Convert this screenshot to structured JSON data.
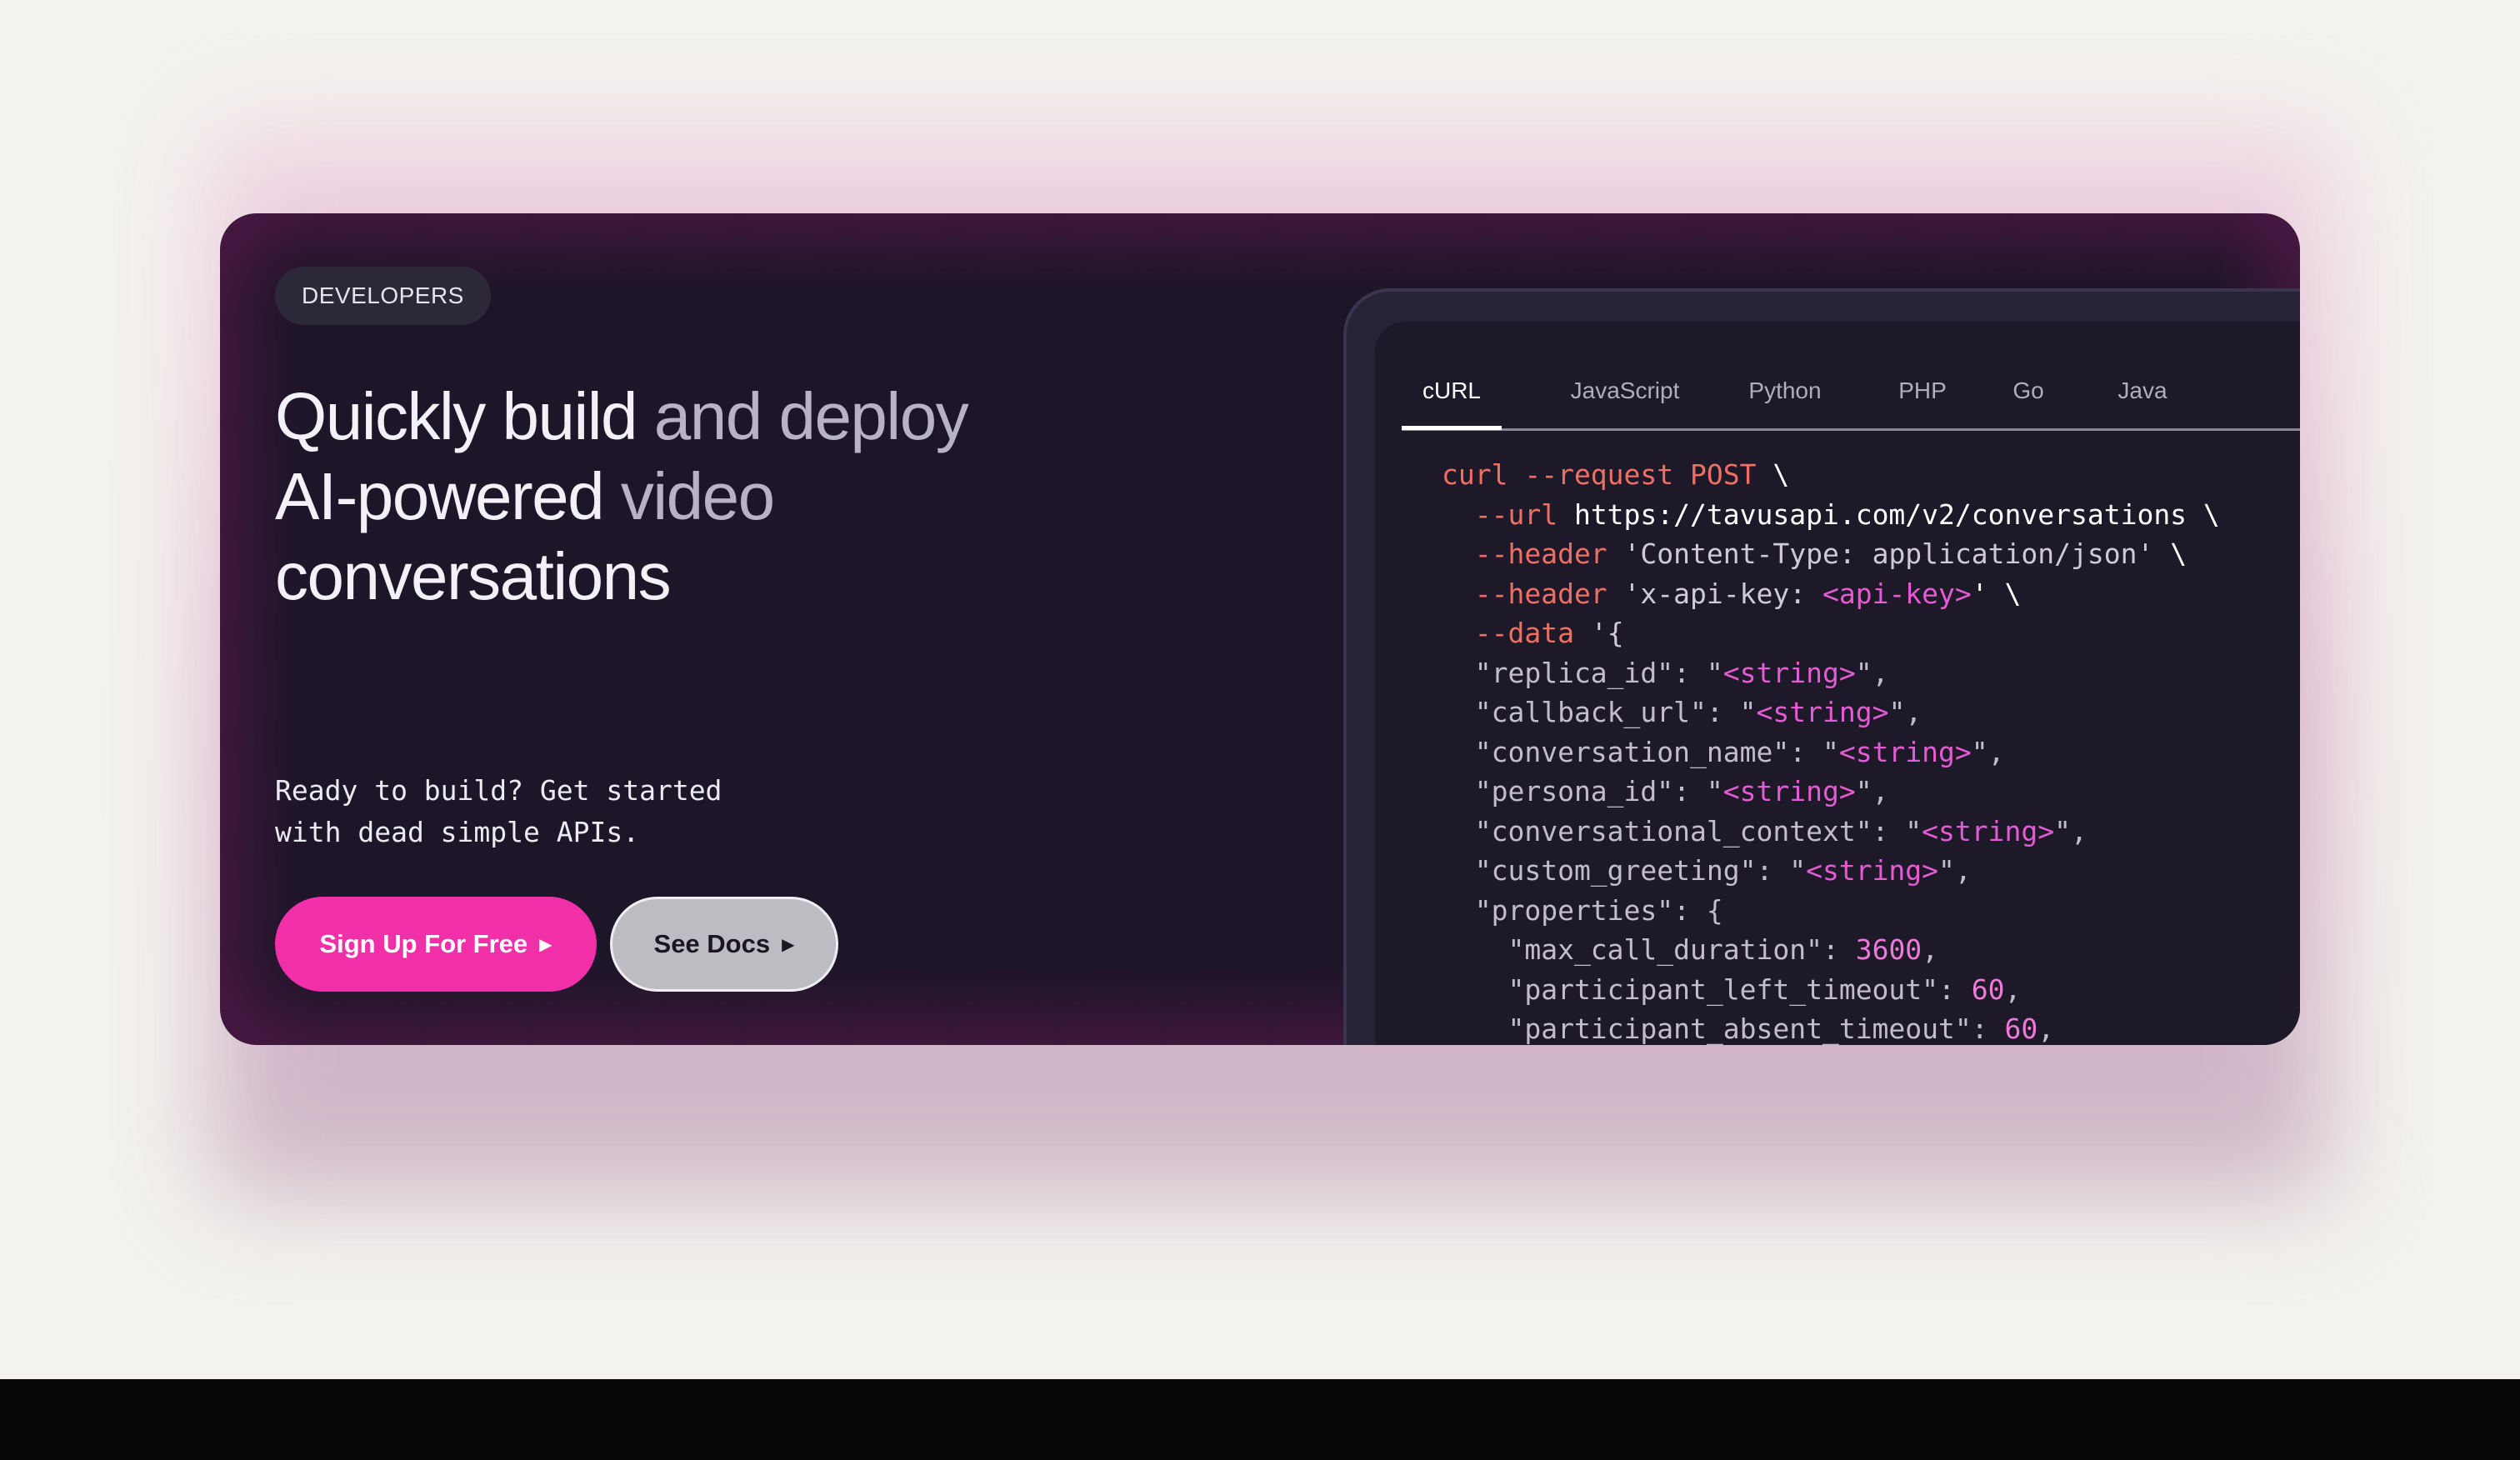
{
  "badge": "DEVELOPERS",
  "headline": {
    "line1_a": "Quickly build",
    "line1_b": " and deploy",
    "line2_a": "AI-powered",
    "line2_b": " video",
    "line3": "conversations"
  },
  "tagline": {
    "line1": "Ready to build? Get started",
    "line2": "with dead simple APIs."
  },
  "buttons": {
    "signup": "Sign Up For Free",
    "docs": "See Docs",
    "arrow_icon": "▶"
  },
  "tabs": [
    "cURL",
    "JavaScript",
    "Python",
    "PHP",
    "Go",
    "Java"
  ],
  "active_tab": "cURL",
  "code": {
    "l1_cmd": "curl --request POST",
    "l1_end": " \\",
    "l2_flag": "  --url",
    "l2_url": " https://tavusapi.com/v2/conversations",
    "l2_end": " \\",
    "l3_flag": "  --header",
    "l3_str": " 'Content-Type: application/json'",
    "l3_end": " \\",
    "l4_flag": "  --header",
    "l4_str": " 'x-api-key: ",
    "l4_ph": "<api-key>",
    "l4_end": "' \\",
    "l5_flag": "  --data",
    "l5_str": " '{",
    "ph_string": "<string>",
    "l6_key": "  \"replica_id\": \"",
    "l7_key": "  \"callback_url\": \"",
    "l8_key": "  \"conversation_name\": \"",
    "l9_key": "  \"persona_id\": \"",
    "l10_key": "  \"conversational_context\": \"",
    "l11_key": "  \"custom_greeting\": \"",
    "l12": "  \"properties\": {",
    "l13_key": "    \"max_call_duration\": ",
    "l13_val": "3600",
    "l14_key": "    \"participant_left_timeout\": ",
    "l14_val": "60",
    "l15_key": "    \"participant_absent_timeout\": ",
    "l15_val": "60",
    "q_comma": "\",",
    "comma": ","
  },
  "colors": {
    "accent": "#f02fa8",
    "card_bg": "#1c1628",
    "flag": "#f06f64",
    "placeholder": "#e45bd3"
  }
}
